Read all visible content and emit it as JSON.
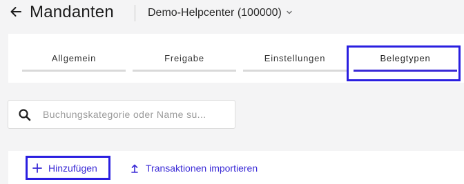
{
  "header": {
    "title": "Mandanten",
    "client_select": "Demo-Helpcenter (100000)"
  },
  "tabs": [
    {
      "label": "Allgemein",
      "active": false
    },
    {
      "label": "Freigabe",
      "active": false
    },
    {
      "label": "Einstellungen",
      "active": false
    },
    {
      "label": "Belegtypen",
      "active": true
    }
  ],
  "search": {
    "placeholder": "Buchungskategorie oder Name su...",
    "value": ""
  },
  "actions": {
    "add_label": "Hinzufügen",
    "import_label": "Transaktionen importieren"
  },
  "colors": {
    "accent": "#3a2ad6",
    "highlight": "#2a1fe0",
    "background": "#f4f4f5"
  }
}
